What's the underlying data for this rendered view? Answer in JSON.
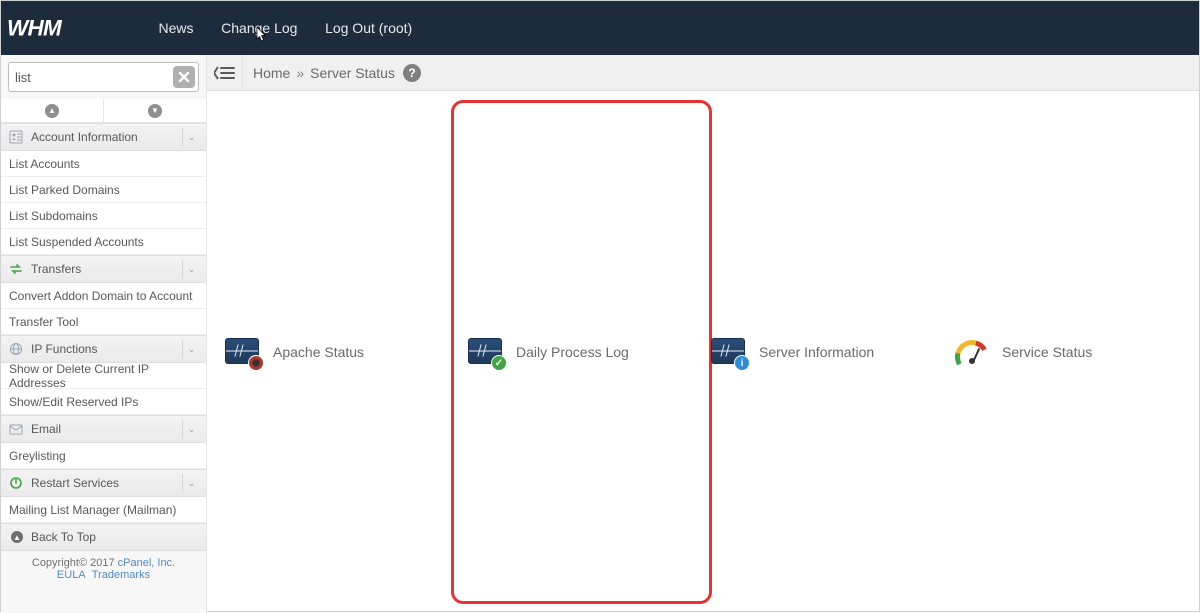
{
  "top": {
    "news": "News",
    "changelog": "Change Log",
    "logout": "Log Out (root)"
  },
  "search": {
    "value": "list"
  },
  "sidebar": {
    "cats": [
      {
        "name": "Account Information",
        "icon": "account-icon"
      },
      {
        "name": "Transfers",
        "icon": "transfers-icon"
      },
      {
        "name": "IP Functions",
        "icon": "ip-icon"
      },
      {
        "name": "Email",
        "icon": "email-icon"
      },
      {
        "name": "Restart Services",
        "icon": "restart-icon"
      }
    ],
    "items": {
      "0": [
        "List Accounts",
        "List Parked Domains",
        "List Subdomains",
        "List Suspended Accounts"
      ],
      "1": [
        "Convert Addon Domain to Account",
        "Transfer Tool"
      ],
      "2": [
        "Show or Delete Current IP Addresses",
        "Show/Edit Reserved IPs"
      ],
      "3": [
        "Greylisting"
      ],
      "4": [
        "Mailing List Manager (Mailman)"
      ]
    },
    "backtop": "Back To Top"
  },
  "footer": {
    "copyright": "Copyright© 2017 ",
    "cpanel": "cPanel, Inc.",
    "eula": "EULA",
    "trademarks": "Trademarks"
  },
  "breadcrumb": {
    "home": "Home",
    "page": "Server Status"
  },
  "tiles": [
    {
      "label": "Apache Status"
    },
    {
      "label": "Daily Process Log"
    },
    {
      "label": "Server Information"
    },
    {
      "label": "Service Status"
    }
  ]
}
